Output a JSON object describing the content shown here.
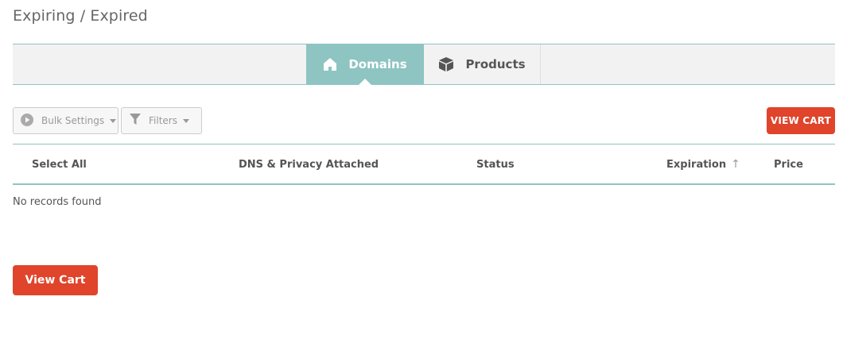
{
  "page": {
    "title": "Expiring / Expired"
  },
  "tabs": [
    {
      "label": "Domains",
      "icon": "home-icon",
      "active": true
    },
    {
      "label": "Products",
      "icon": "box-icon",
      "active": false
    }
  ],
  "toolbar": {
    "bulk_settings_label": "Bulk Settings",
    "filters_label": "Filters",
    "view_cart_label": "VIEW CART"
  },
  "table": {
    "columns": [
      "Select All",
      "DNS & Privacy Attached",
      "Status",
      "Expiration",
      "Price"
    ],
    "sort_indicator": "↑",
    "empty_text": "No records found"
  },
  "footer": {
    "view_cart_label": "View Cart"
  },
  "colors": {
    "accent_teal": "#8ec4c2",
    "cta_red": "#e0442b",
    "tab_bg": "#f2f2f2"
  }
}
